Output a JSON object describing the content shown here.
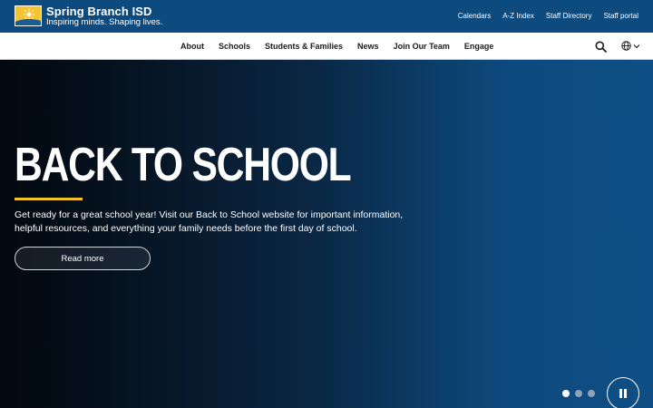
{
  "header": {
    "logo_name": "Spring Branch ISD",
    "logo_tagline": "Inspiring minds. Shaping lives.",
    "utility_links": [
      "Calendars",
      "A-Z Index",
      "Staff Directory",
      "Staff portal"
    ]
  },
  "nav": {
    "items": [
      "About",
      "Schools",
      "Students & Families",
      "News",
      "Join Our Team",
      "Engage"
    ],
    "search_icon": "search-icon",
    "language_icon": "globe-icon"
  },
  "hero": {
    "title": "BACK TO SCHOOL",
    "description": "Get ready for a great school year! Visit our Back to School website for important information, helpful resources, and everything your family needs before the first day of school.",
    "button_label": "Read more",
    "slide_count": 3,
    "active_slide": 1,
    "pause_icon": "pause-icon"
  },
  "colors": {
    "header_bg": "#0d4a7e",
    "accent": "#f2c229",
    "nav_bg": "#ffffff"
  }
}
